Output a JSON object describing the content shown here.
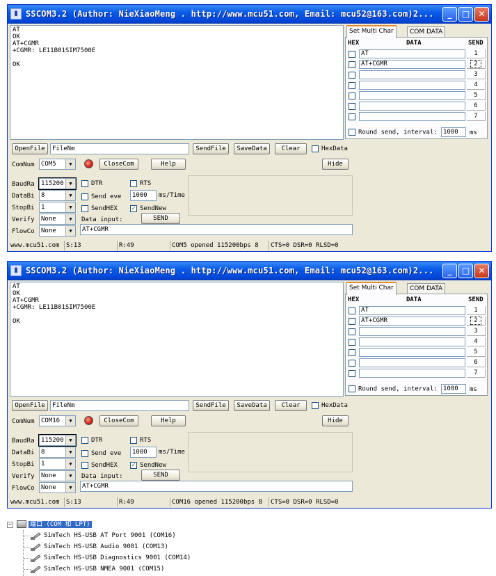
{
  "windows": [
    {
      "title": "SSCOM3.2 (Author: NieXiaoMeng . http://www.mcu51.com, Email: mcu52@163.com)2...",
      "received_lines": [
        "AT",
        "OK",
        "AT+CGMR",
        "+CGMR: LE11B01SIM7500E",
        "",
        "OK"
      ],
      "tabs": [
        "Set Multi Char",
        "COM DATA"
      ],
      "multi_headers": {
        "hex": "HEX",
        "data": "DATA",
        "send": "SEND"
      },
      "multi_rows": [
        {
          "data": "AT",
          "send": "1"
        },
        {
          "data": "AT+CGMR",
          "send": "2"
        },
        {
          "data": "",
          "send": "3"
        },
        {
          "data": "",
          "send": "4"
        },
        {
          "data": "",
          "send": "5"
        },
        {
          "data": "",
          "send": "6"
        },
        {
          "data": "",
          "send": "7"
        }
      ],
      "round_send_label": "Round send, interval:",
      "round_interval": "1000",
      "round_unit": "ms",
      "buttons": {
        "open_file": "OpenFile",
        "send_file": "SendFile",
        "save_data": "SaveData",
        "clear": "Clear",
        "close_com": "CloseCom",
        "help": "Help",
        "hide": "Hide",
        "send": "SEND"
      },
      "file_name": "FileNm",
      "hex_data_label": "HexData",
      "com_num_label": "ComNum",
      "com_num": "COM5",
      "baud_label": "BaudRa",
      "baud_value": "115200",
      "databits_label": "DataBi",
      "databits_value": "8",
      "stopbits_label": "StopBi",
      "stopbits_value": "1",
      "verify_label": "Verify",
      "verify_value": "None",
      "flow_label": "FlowCo",
      "flow_value": "None",
      "dtr_label": "DTR",
      "rts_label": "RTS",
      "send_every_label": "Send eve",
      "send_every_value": "1000",
      "send_every_unit": "ms/Time",
      "send_hex_label": "SendHEX",
      "send_new_label": "SendNew",
      "data_input_label": "Data input:",
      "data_input_value": "AT+CGMR",
      "status": {
        "site": "www.mcu51.com",
        "sent": "S:13",
        "received": "R:49",
        "port_state": "COM5 opened 115200bps  8",
        "lines": "CTS=0 DSR=0 RLSD=0"
      }
    },
    {
      "title": "SSCOM3.2 (Author: NieXiaoMeng . http://www.mcu51.com, Email: mcu52@163.com)2...",
      "received_lines": [
        "AT",
        "OK",
        "AT+CGMR",
        "+CGMR: LE11B01SIM7500E",
        "",
        "OK"
      ],
      "tabs": [
        "Set Multi Char",
        "COM DATA"
      ],
      "multi_headers": {
        "hex": "HEX",
        "data": "DATA",
        "send": "SEND"
      },
      "multi_rows": [
        {
          "data": "AT",
          "send": "1"
        },
        {
          "data": "AT+CGMR",
          "send": "2"
        },
        {
          "data": "",
          "send": "3"
        },
        {
          "data": "",
          "send": "4"
        },
        {
          "data": "",
          "send": "5"
        },
        {
          "data": "",
          "send": "6"
        },
        {
          "data": "",
          "send": "7"
        }
      ],
      "round_send_label": "Round send, interval:",
      "round_interval": "1000",
      "round_unit": "ms",
      "buttons": {
        "open_file": "OpenFile",
        "send_file": "SendFile",
        "save_data": "SaveData",
        "clear": "Clear",
        "close_com": "CloseCom",
        "help": "Help",
        "hide": "Hide",
        "send": "SEND"
      },
      "file_name": "FileNm",
      "hex_data_label": "HexData",
      "com_num_label": "ComNum",
      "com_num": "COM16",
      "baud_label": "BaudRa",
      "baud_value": "115200",
      "databits_label": "DataBi",
      "databits_value": "8",
      "stopbits_label": "StopBi",
      "stopbits_value": "1",
      "verify_label": "Verify",
      "verify_value": "None",
      "flow_label": "FlowCo",
      "flow_value": "None",
      "dtr_label": "DTR",
      "rts_label": "RTS",
      "send_every_label": "Send eve",
      "send_every_value": "1000",
      "send_every_unit": "ms/Time",
      "send_hex_label": "SendHEX",
      "send_new_label": "SendNew",
      "data_input_label": "Data input:",
      "data_input_value": "AT+CGMR",
      "status": {
        "site": "www.mcu51.com",
        "sent": "S:13",
        "received": "R:49",
        "port_state": "COM16 opened 115200bps  8",
        "lines": "CTS=0 DSR=0 RLSD=0"
      }
    }
  ],
  "device_tree": {
    "root_label": "端口 (COM 和 LPT)",
    "items": [
      "SimTech HS-USB AT Port 9001 (COM16)",
      "SimTech HS-USB Audio 9001 (COM13)",
      "SimTech HS-USB Diagnostics 9001 (COM14)",
      "SimTech HS-USB NMEA 9001 (COM15)"
    ]
  },
  "colors": {
    "titlebar": "#0a5ce8",
    "window_bg": "#ece9d8",
    "selection": "#316ac5"
  }
}
